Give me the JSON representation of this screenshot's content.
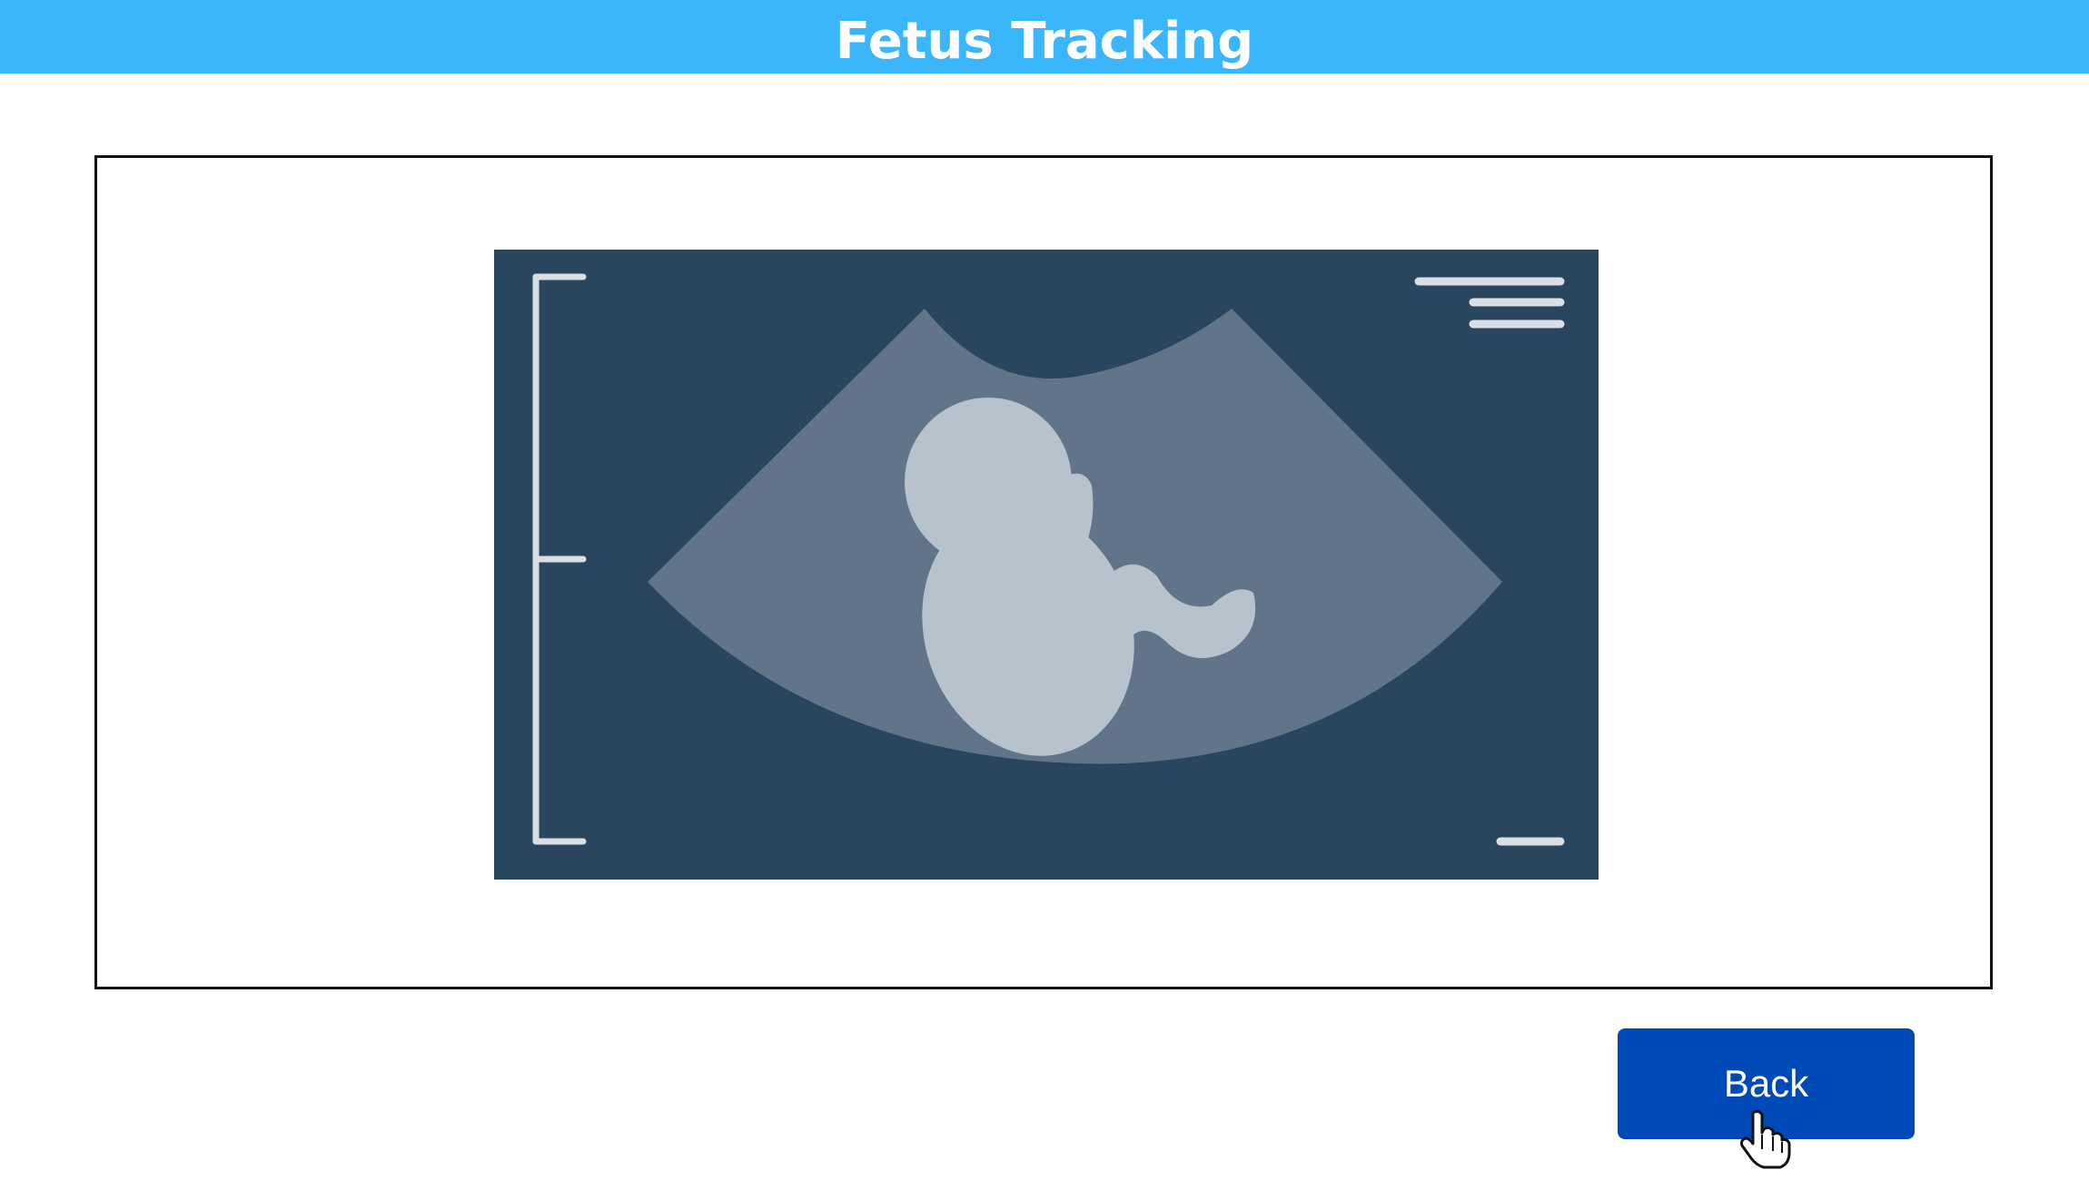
{
  "header": {
    "title": "Fetus Tracking",
    "background_color": "#3bb6fd"
  },
  "ultrasound": {
    "icon": "ultrasound-fetus-image",
    "colors": {
      "screen": "#2a465f",
      "cone": "#627489",
      "fetus": "#b8c2cc",
      "marks": "#d9dfe5"
    }
  },
  "actions": {
    "back_label": "Back",
    "back_color": "#004ab8"
  },
  "cursor": {
    "icon": "hand-pointer-icon"
  }
}
